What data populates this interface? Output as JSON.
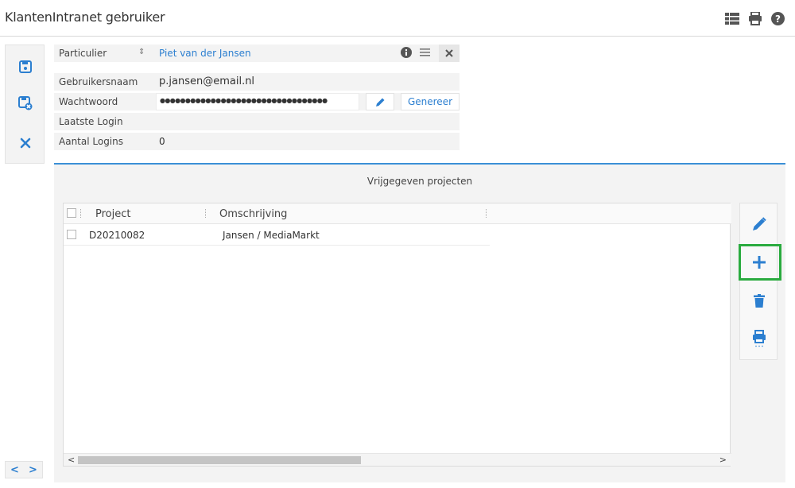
{
  "app": {
    "title": "KlantenIntranet gebruiker"
  },
  "header_icons": [
    "list-icon",
    "print-icon",
    "help-icon"
  ],
  "toolbar": {
    "buttons": [
      "save-icon",
      "save-close-icon",
      "close-icon"
    ]
  },
  "form": {
    "type_value": "Particulier",
    "contact_name": "Piet van der Jansen",
    "username_label": "Gebruikersnaam",
    "username_value": "p.jansen@email.nl",
    "password_label": "Wachtwoord",
    "password_value": "●●●●●●●●●●●●●●●●●●●●●●●●●●●●●●●●●",
    "generate_label": "Genereer",
    "last_login_label": "Laatste Login",
    "last_login_value": "",
    "login_count_label": "Aantal Logins",
    "login_count_value": "0"
  },
  "projects": {
    "title": "Vrijgegeven projecten",
    "columns": [
      "Project",
      "Omschrijving"
    ],
    "rows": [
      {
        "project": "D20210082",
        "description": "Jansen / MediaMarkt"
      }
    ],
    "scroll_left": "<",
    "scroll_right": ">"
  },
  "side_actions": [
    "edit-icon",
    "add-icon",
    "delete-icon",
    "print-icon"
  ],
  "pager": {
    "prev": "<",
    "next": ">"
  },
  "colors": {
    "accent": "#2c7fd0",
    "highlight": "#2aab3f",
    "panel": "#f3f3f3"
  }
}
